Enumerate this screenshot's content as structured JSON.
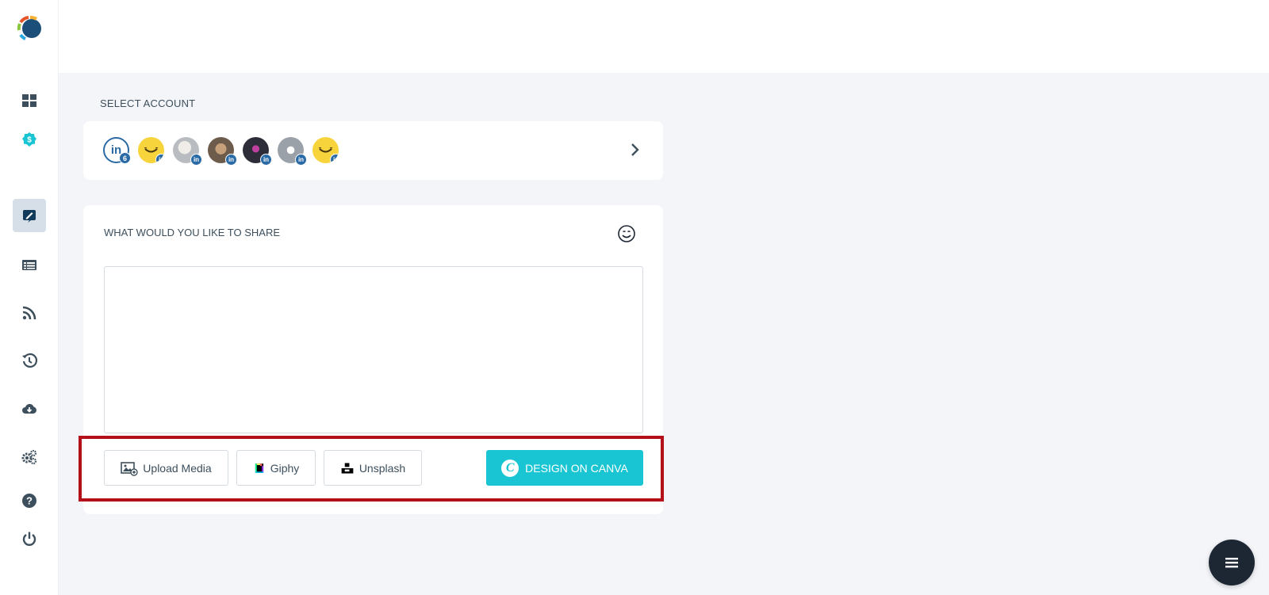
{
  "account": {
    "section_title": "SELECT ACCOUNT",
    "linkedin_label": "in",
    "linkedin_count": "6",
    "badge_label": "in"
  },
  "share": {
    "section_title": "WHAT WOULD YOU LIKE TO SHARE",
    "text_value": "",
    "upload_label": "Upload Media",
    "giphy_label": "Giphy",
    "unsplash_label": "Unsplash",
    "canva_label": "DESIGN ON CANVA",
    "canva_logo_letter": "C"
  },
  "sidebar": {
    "items": [
      {
        "icon": "dashboard-icon"
      },
      {
        "icon": "dollar-badge-icon"
      },
      {
        "icon": "compose-icon",
        "active": true
      },
      {
        "icon": "list-icon"
      },
      {
        "icon": "rss-icon"
      },
      {
        "icon": "history-icon"
      },
      {
        "icon": "cloud-download-icon"
      },
      {
        "icon": "settings-icon"
      },
      {
        "icon": "help-icon"
      },
      {
        "icon": "power-icon"
      }
    ]
  },
  "colors": {
    "accent": "#1ac5d3",
    "linkedin": "#2a6aa5",
    "highlight": "#b3101a",
    "fab": "#1d2733"
  }
}
